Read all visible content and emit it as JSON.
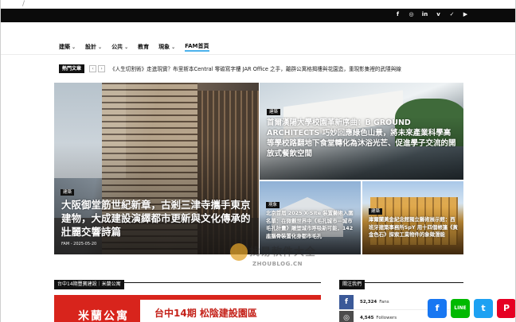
{
  "browser": {
    "slash": "/"
  },
  "social_icons": [
    {
      "icon": "facebook-icon",
      "glyph": "f"
    },
    {
      "icon": "instagram-icon",
      "glyph": "◎"
    },
    {
      "icon": "linkedin-icon",
      "glyph": "in"
    },
    {
      "icon": "vimeo-icon",
      "glyph": "v"
    },
    {
      "icon": "vk-icon",
      "glyph": "✓"
    },
    {
      "icon": "youtube-icon",
      "glyph": "▶"
    }
  ],
  "nav": {
    "items": [
      {
        "label": "建築",
        "dropdown": true
      },
      {
        "label": "設計",
        "dropdown": true
      },
      {
        "label": "公共",
        "dropdown": true
      },
      {
        "label": "教育",
        "dropdown": false
      },
      {
        "label": "現象",
        "dropdown": true
      },
      {
        "label": "FAM首頁",
        "dropdown": false,
        "active": true
      }
    ],
    "accent": "#4db2ec"
  },
  "ticker": {
    "tag": "熱門文章",
    "prev": "‹",
    "next": "›",
    "text": "《人生切割術》走進現實？布里斯本Central 零碳寫字樓 JAR Office 之手，離群公寓格揭樓與花園造，重現影集裡的武隱與線"
  },
  "tiles": {
    "main": {
      "category": "建築",
      "title": "大阪御堂筋世紀新章，古剎三津寺攜手東京建物，大成建設演繹都市更新與文化傳承的壯麗交響詩篇",
      "author": "FAM",
      "date": "2025-05-20"
    },
    "r1": {
      "category": "建築",
      "title": "首爾漢陽大學校園革新序曲：B GROUND ARCHITECTS 巧妙回應綠色山景，將未來產業科學高等學校路翻地下食堂轉化為沐浴光芒、促進學子交流的開放式餐飲空間"
    },
    "r2": {
      "category": "現象",
      "title": "北京首屆 2025 X-Site 裝置藝術入圍名單：在微觀世界中《毛孔城市—城市毛孔計畫》雕塑城市呼吸新可能，142座腦骨裝置化身都市毛孔"
    },
    "r3": {
      "category": "建築",
      "title": "庫爾蘭黃金紀念館獨立藝術展示館：西班牙建築事務所SpY 用十四個帳篷《黃金色石》探索工業物件的象徵潛能"
    }
  },
  "watermark": {
    "cn": "找易軟件大全",
    "en": "ZHOUBLOG.CN"
  },
  "sections": {
    "left": "台中14期豐寶建設｜米蘭公寓",
    "right": "關注我們"
  },
  "banner": {
    "left_text": "米蘭公寓",
    "right_text": "台中14期 松陰建設園區"
  },
  "follow": [
    {
      "icon": "facebook-icon",
      "glyph": "f",
      "count": "52,324",
      "unit": "Fans",
      "color": "#3b5998"
    },
    {
      "icon": "instagram-icon",
      "glyph": "◎",
      "count": "4,545",
      "unit": "Followers",
      "color": "#4c4c4c"
    }
  ],
  "share": [
    {
      "icon": "facebook-share-icon",
      "glyph": "f",
      "color": "#1877f2"
    },
    {
      "icon": "line-share-icon",
      "glyph": "LINE",
      "color": "#00b900"
    },
    {
      "icon": "twitter-share-icon",
      "glyph": "t",
      "color": "#1da1f2"
    },
    {
      "icon": "pinterest-share-icon",
      "glyph": "P",
      "color": "#e60023"
    }
  ]
}
